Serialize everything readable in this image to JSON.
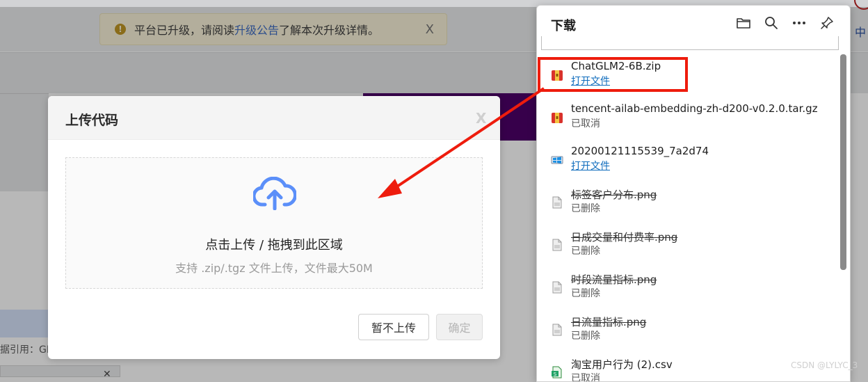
{
  "notice": {
    "text_before": "平台已升级，请阅读",
    "link_text": "升级公告",
    "text_after": "了解本次升级详情。",
    "close": "X"
  },
  "background": {
    "lang": "中",
    "ref_text": "据引用：GE"
  },
  "upload_dialog": {
    "title": "上传代码",
    "close": "X",
    "drop_main": "点击上传 / 拖拽到此区域",
    "drop_hint": "支持 .zip/.tgz 文件上传，文件最大50M",
    "skip_button": "暂不上传",
    "confirm_button": "确定"
  },
  "downloads": {
    "title": "下载",
    "tools": [
      "folder-icon",
      "search-icon",
      "more-icon",
      "pin-icon"
    ],
    "items": [
      {
        "name": "ChatGLM2-6B.zip",
        "status": "打开文件",
        "status_type": "link",
        "icon": "zip-archive-icon"
      },
      {
        "name": "tencent-ailab-embedding-zh-d200-v0.2.0.tar.gz",
        "status": "已取消",
        "status_type": "text",
        "icon": "zip-archive-icon"
      },
      {
        "name": "20200121115539_7a2d74",
        "status": "打开文件",
        "status_type": "link",
        "icon": "app-file-icon"
      },
      {
        "name": "标签客户分布.png",
        "status": "已删除",
        "status_type": "deleted",
        "icon": "image-file-icon"
      },
      {
        "name": "日成交量和付费率.png",
        "status": "已删除",
        "status_type": "deleted",
        "icon": "image-file-icon"
      },
      {
        "name": "时段流量指标.png",
        "status": "已删除",
        "status_type": "deleted",
        "icon": "image-file-icon"
      },
      {
        "name": "日流量指标.png",
        "status": "已删除",
        "status_type": "deleted",
        "icon": "image-file-icon"
      },
      {
        "name": "淘宝用户行为 (2).csv",
        "status": "已取消",
        "status_type": "text",
        "icon": "csv-file-icon"
      }
    ]
  },
  "watermark": "CSDN @LYLYC_3",
  "colors": {
    "link_blue": "#0f6cbd",
    "annotation_red": "#ee1c0d",
    "upload_icon_blue": "#5b8ff9"
  }
}
